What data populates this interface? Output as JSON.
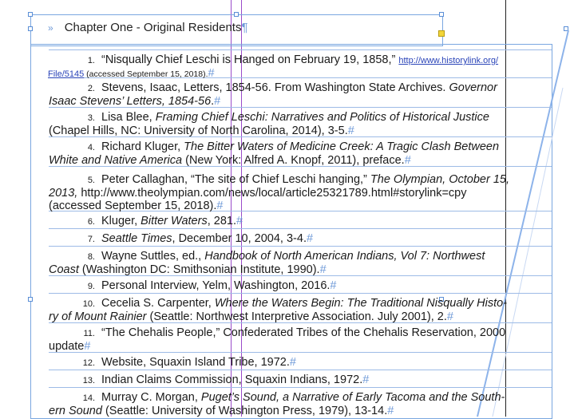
{
  "chapter": {
    "arrow": "»",
    "title": "Chapter One - Original Residents",
    "mark": "¶"
  },
  "notes": [
    {
      "num": "1.",
      "l1a": "“Nisqually Chief Leschi is Hanged on February 19, 1858,” ",
      "l1link": "http://www.historylink.org/",
      "l2link": "File/5145",
      "l2": " (accessed September 15, 2018).",
      "mark": "#"
    },
    {
      "num": "2.",
      "l1a": "Stevens, Isaac, Letters, 1854-56. From Washington State Archives. ",
      "l1i": "Governor",
      "l2i": "Isaac Stevens’ Letters, 1854-56",
      "l2": ".",
      "mark": "#"
    },
    {
      "num": "3.",
      "l1a": "Lisa Blee, ",
      "l1i": "Framing Chief Leschi: Narratives and Politics of Historical Justice",
      "l2": "(Chapel Hills, NC: University of North Carolina, 2014), 3-5.",
      "mark": "#"
    },
    {
      "num": "4.",
      "l1a": "Richard Kluger, ",
      "l1i": "The Bitter Waters of Medicine Creek: A Tragic Clash Between",
      "l2i": "White and Native America",
      "l2": " (New York: Alfred A. Knopf, 2011), preface.",
      "mark": "#"
    },
    {
      "num": "5.",
      "l1a": "Peter Callaghan, “The site of Chief Leschi hanging,” ",
      "l1i": "The Olympian, October 15,",
      "l2i": "2013,",
      "l2": " http://www.theolympian.com/news/local/article25321789.html#storylink=cpy",
      "l3": "(accessed September 15, 2018).",
      "mark": "#"
    },
    {
      "num": "6.",
      "l1a": "Kluger, ",
      "l1i": "Bitter Waters",
      "l1b": ", 281.",
      "mark": "#"
    },
    {
      "num": "7.",
      "l1i": "Seattle Times",
      "l1b": ", December 10, 2004, 3-4.",
      "mark": "#"
    },
    {
      "num": "8.",
      "l1a": "Wayne Suttles, ed., ",
      "l1i": "Handbook of North American Indians, Vol 7: Northwest",
      "l2i": "Coast",
      "l2": " (Washington DC: Smithsonian Institute, 1990).",
      "mark": "#"
    },
    {
      "num": "9.",
      "l1a": "Personal Interview, Yelm, Washington, 2016.",
      "mark": "#"
    },
    {
      "num": "10.",
      "l1a": "Cecelia S. Carpenter, ",
      "l1i": "Where the Waters Begin: The Traditional Nisqually Histo-",
      "l2i": "ry of Mount Rainier",
      "l2": " (Seattle: Northwest Interpretive Association. July 2001), 2.",
      "mark": "#"
    },
    {
      "num": "11.",
      "l1a": "“The Chehalis People,” Confederated Tribes of the Chehalis Reservation, 2000",
      "l2": "update",
      "mark": "#"
    },
    {
      "num": "12.",
      "l1a": "Website, Squaxin Island Tribe, 1972.",
      "mark": "#"
    },
    {
      "num": "13.",
      "l1a": "Indian Claims Commission, Squaxin Indians, 1972.",
      "mark": "#"
    },
    {
      "num": "14.",
      "l1a": "Murray C. Morgan, ",
      "l1i": "Puget’s Sound, a Narrative of Early Tacoma and the South-",
      "l2i": "ern Sound",
      "l2": " (Seattle: University of Washington Press, 1979), 13-14.",
      "mark": "#"
    }
  ]
}
